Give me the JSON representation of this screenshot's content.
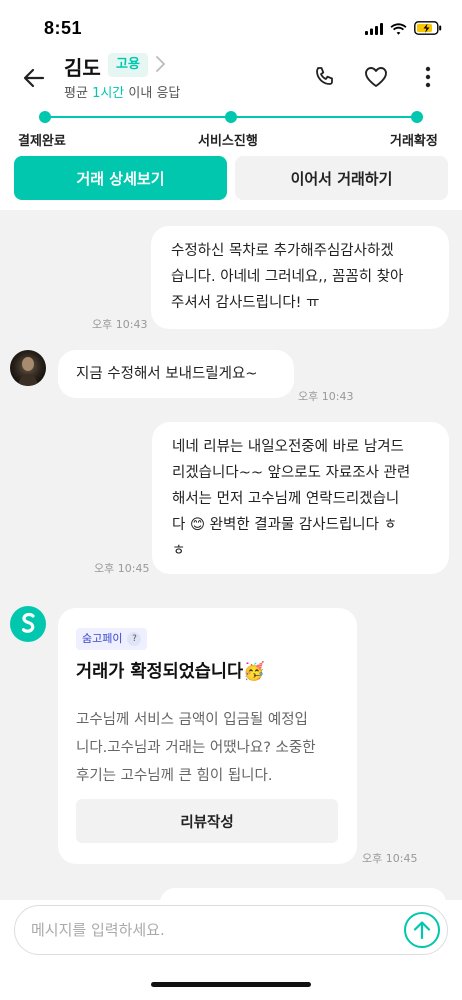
{
  "status_bar": {
    "time": "8:51"
  },
  "header": {
    "name": "김도",
    "badge": "고용",
    "response_prefix": "평균 ",
    "response_highlight": "1시간",
    "response_suffix": " 이내 응답"
  },
  "progress": {
    "steps": [
      "결제완료",
      "서비스진행",
      "거래확정"
    ]
  },
  "actions": {
    "detail": "거래 상세보기",
    "continue": "이어서 거래하기"
  },
  "messages": [
    {
      "direction": "out",
      "text_lines": [
        "수정하신 목차로 추가해주심감사하겠",
        "습니다.  아네네 그러네요,, 꼼꼼히 찾아",
        "주셔서 감사드립니다! ㅠ"
      ],
      "time": "오후 10:43"
    },
    {
      "direction": "in",
      "text_lines": [
        "지금 수정해서 보내드릴게요~"
      ],
      "time": "오후 10:43"
    },
    {
      "direction": "out",
      "text_lines": [
        "네네 리뷰는 내일오전중에 바로 남겨드",
        "리겠습니다~~ 앞으로도 자료조사 관련",
        "해서는 먼저 고수님께 연락드리겠습니",
        "다 😊 완벽한 결과물 감사드립니다 ㅎ",
        "ㅎ"
      ],
      "time": "오후 10:45"
    }
  ],
  "pay_card": {
    "tag": "숨고페이",
    "tag_help": "?",
    "title": "거래가 확정되었습니다🥳",
    "desc_lines": [
      "고수님께 서비스 금액이 입금될 예정입",
      "니다.고수님과 거래는 어땠나요? 소중한",
      "후기는 고수님께 큰 힘이 됩니다."
    ],
    "button": "리뷰작성",
    "time": "오후 10:45"
  },
  "input": {
    "placeholder": "메시지를 입력하세요."
  },
  "colors": {
    "accent": "#00c7ae",
    "chat_bg": "#f2f2f2"
  }
}
